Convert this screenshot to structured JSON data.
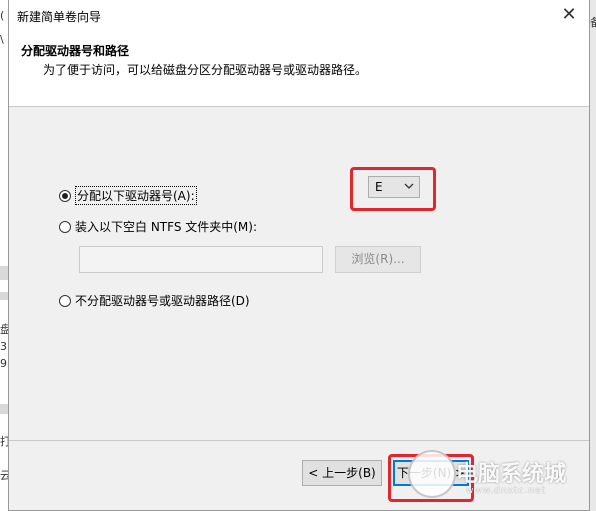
{
  "dialog": {
    "title": "新建简单卷向导",
    "close_glyph": "✕",
    "header_title": "分配驱动器号和路径",
    "header_subtitle": "为了便于访问，可以给磁盘分区分配驱动器号或驱动器路径。"
  },
  "options": {
    "assign_letter": "分配以下驱动器号(A):",
    "mount_folder": "装入以下空白 NTFS 文件夹中(M):",
    "no_assign": "不分配驱动器号或驱动器路径(D)",
    "selected": "assign_letter"
  },
  "drive_letter": {
    "value": "E"
  },
  "path": {
    "value": ""
  },
  "browse_label": "浏览(R)...",
  "buttons": {
    "back": "< 上一步(B)",
    "next": "下一步(N) >"
  },
  "watermark": {
    "text": "电脑系统城",
    "url": "www.dnxtc.net"
  },
  "background": {
    "left_fragments": [
      "(",
      "\\",
      "盘",
      "3",
      "9",
      "打",
      "云"
    ],
    "right_fragment": "备"
  },
  "colors": {
    "highlight": "#e3262d",
    "focus_blue": "#0078d7"
  }
}
